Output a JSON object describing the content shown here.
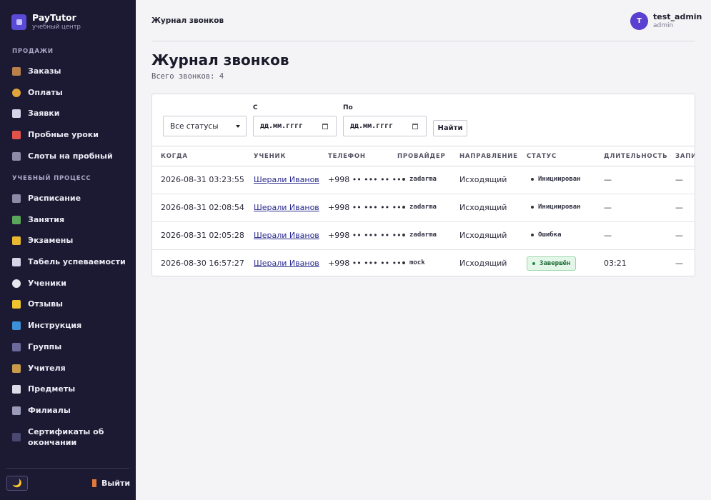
{
  "brand": {
    "name": "PayTutor",
    "subtitle": "учебный центр"
  },
  "sidebar": {
    "sections": [
      {
        "title": "ПРОДАЖИ"
      },
      {
        "title": "УЧЕБНЫЙ ПРОЦЕСС"
      }
    ],
    "items": [
      {
        "label": "Заказы",
        "icon": "package-icon"
      },
      {
        "label": "Оплаты",
        "icon": "money-bag-icon"
      },
      {
        "label": "Заявки",
        "icon": "document-icon"
      },
      {
        "label": "Пробные уроки",
        "icon": "gift-icon"
      },
      {
        "label": "Слоты на пробный",
        "icon": "calendar-icon"
      },
      {
        "label": "Расписание",
        "icon": "calendar-icon"
      },
      {
        "label": "Занятия",
        "icon": "books-icon"
      },
      {
        "label": "Экзамены",
        "icon": "trophy-icon"
      },
      {
        "label": "Табель успеваемости",
        "icon": "chart-icon"
      },
      {
        "label": "Ученики",
        "icon": "speech-bubble-icon"
      },
      {
        "label": "Отзывы",
        "icon": "star-icon"
      },
      {
        "label": "Инструкция",
        "icon": "book-icon"
      },
      {
        "label": "Группы",
        "icon": "people-icon"
      },
      {
        "label": "Учителя",
        "icon": "teacher-icon"
      },
      {
        "label": "Предметы",
        "icon": "open-book-icon"
      },
      {
        "label": "Филиалы",
        "icon": "building-icon"
      },
      {
        "label": "Сертификаты об окончании",
        "icon": "graduation-cap-icon"
      }
    ],
    "theme_toggle": "🌙",
    "logout_label": "Выйти"
  },
  "header": {
    "title": "Журнал звонков",
    "user": {
      "initial": "T",
      "name": "test_admin",
      "role": "admin"
    }
  },
  "main": {
    "title": "Журнал звонков",
    "count_text": "Всего звонков: 4",
    "filters": {
      "status_value": "Все статусы",
      "from_label": "С",
      "from_placeholder": "дд.мм.гггг",
      "to_label": "По",
      "to_placeholder": "дд.мм.гггг",
      "find_label": "Найти"
    },
    "columns": [
      "КОГДА",
      "УЧЕНИК",
      "ТЕЛЕФОН",
      "ПРОВАЙДЕР",
      "НАПРАВЛЕНИЕ",
      "СТАТУС",
      "ДЛИТЕЛЬНОСТЬ",
      "ЗАПИСЬ"
    ],
    "rows": [
      {
        "when": "2026-08-31 03:23:55",
        "student": "Шерали Иванов",
        "phone": "+998 •• ••• •• ••",
        "provider": "zadarma",
        "direction": "Исходящий",
        "status": "Инициирован",
        "duration": "—",
        "record": "—"
      },
      {
        "when": "2026-08-31 02:08:54",
        "student": "Шерали Иванов",
        "phone": "+998 •• ••• •• ••",
        "provider": "zadarma",
        "direction": "Исходящий",
        "status": "Инициирован",
        "duration": "—",
        "record": "—"
      },
      {
        "when": "2026-08-31 02:05:28",
        "student": "Шерали Иванов",
        "phone": "+998 •• ••• •• ••",
        "provider": "zadarma",
        "direction": "Исходящий",
        "status": "Ошибка",
        "duration": "—",
        "record": "—"
      },
      {
        "when": "2026-08-30 16:57:27",
        "student": "Шерали Иванов",
        "phone": "+998 •• ••• •• ••",
        "provider": "mock",
        "direction": "Исходящий",
        "status": "Завершён",
        "duration": "03:21",
        "record": "—"
      }
    ]
  },
  "colors": {
    "sidebar_bg": "#1c1a33",
    "accent": "#5a3fd0",
    "success": "#1e8b45"
  }
}
